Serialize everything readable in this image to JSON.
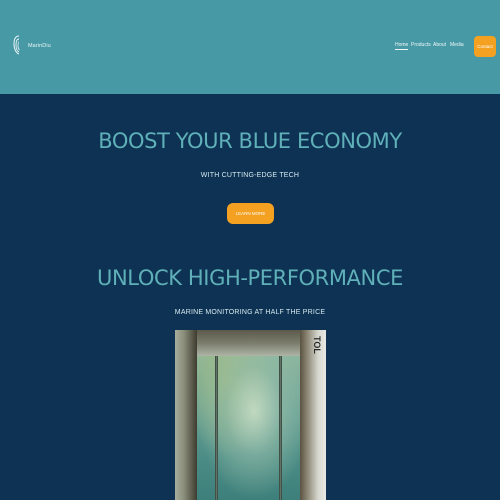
{
  "header": {
    "brand": "MarinDiu",
    "nav": [
      {
        "label": "Home",
        "active": true
      },
      {
        "label": "Products",
        "active": false
      },
      {
        "label": "About",
        "active": false
      },
      {
        "label": "Media",
        "active": false
      }
    ],
    "contact_label": "Contact"
  },
  "hero": {
    "headline_1": "BOOST YOUR BLUE ECONOMY",
    "subline_1": "WITH CUTTING-EDGE TECH",
    "cta_label": "LEARN MORE",
    "headline_2": "UNLOCK HIGH-PERFORMANCE",
    "subline_2": "MARINE MONITORING AT HALF THE PRICE"
  },
  "photo": {
    "icon": "underwater-camera-photo",
    "side_text": "TOL"
  },
  "colors": {
    "header_bg": "#4699a5",
    "page_bg": "#0d3254",
    "accent": "#f4a020",
    "headline": "#5fb0b8"
  }
}
